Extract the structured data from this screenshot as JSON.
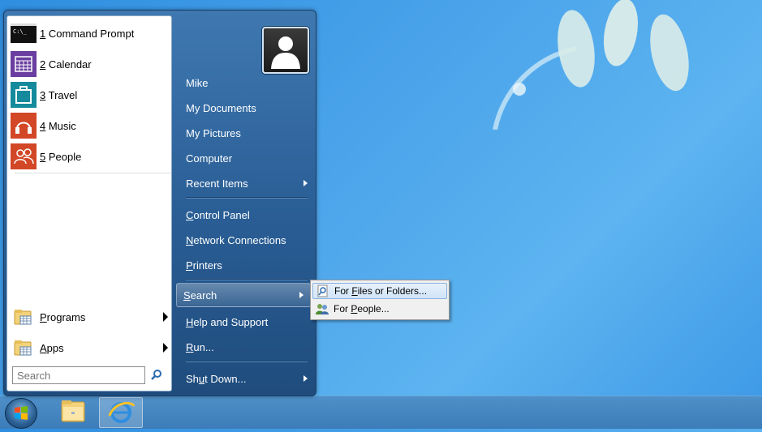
{
  "start_menu": {
    "pinned": [
      {
        "number": "1",
        "label": " Command Prompt",
        "icon": "command-prompt-icon"
      },
      {
        "number": "2",
        "label": " Calendar",
        "icon": "calendar-icon"
      },
      {
        "number": "3",
        "label": " Travel",
        "icon": "travel-icon"
      },
      {
        "number": "4",
        "label": " Music",
        "icon": "music-icon"
      },
      {
        "number": "5",
        "label": " People",
        "icon": "people-icon"
      }
    ],
    "programs": {
      "accel": "P",
      "rest": "rograms"
    },
    "apps": {
      "accel": "A",
      "rest": "pps"
    },
    "search": {
      "placeholder": "Search"
    },
    "right": {
      "user": "Mike",
      "documents": "My Documents",
      "pictures": "My Pictures",
      "computer": "Computer",
      "recent": "Recent Items",
      "control_panel": {
        "accel": "C",
        "rest": "ontrol Panel"
      },
      "network": {
        "accel": "N",
        "rest": "etwork Connections"
      },
      "printers": {
        "accel": "P",
        "rest": "rinters"
      },
      "search": {
        "accel": "S",
        "rest": "earch"
      },
      "help": {
        "accel": "H",
        "rest": "elp and Support"
      },
      "run": {
        "accel": "R",
        "rest": "un..."
      },
      "shutdown": {
        "pre": "Sh",
        "accel": "u",
        "rest": "t Down..."
      }
    }
  },
  "search_submenu": {
    "files": {
      "pre": "For ",
      "accel": "F",
      "rest": "iles or Folders..."
    },
    "people": {
      "pre": "For ",
      "accel": "P",
      "rest": "eople..."
    }
  },
  "colors": {
    "accent": "#295d94",
    "desktop": "#4aa3ea",
    "taskbar": "#4f90c9"
  }
}
